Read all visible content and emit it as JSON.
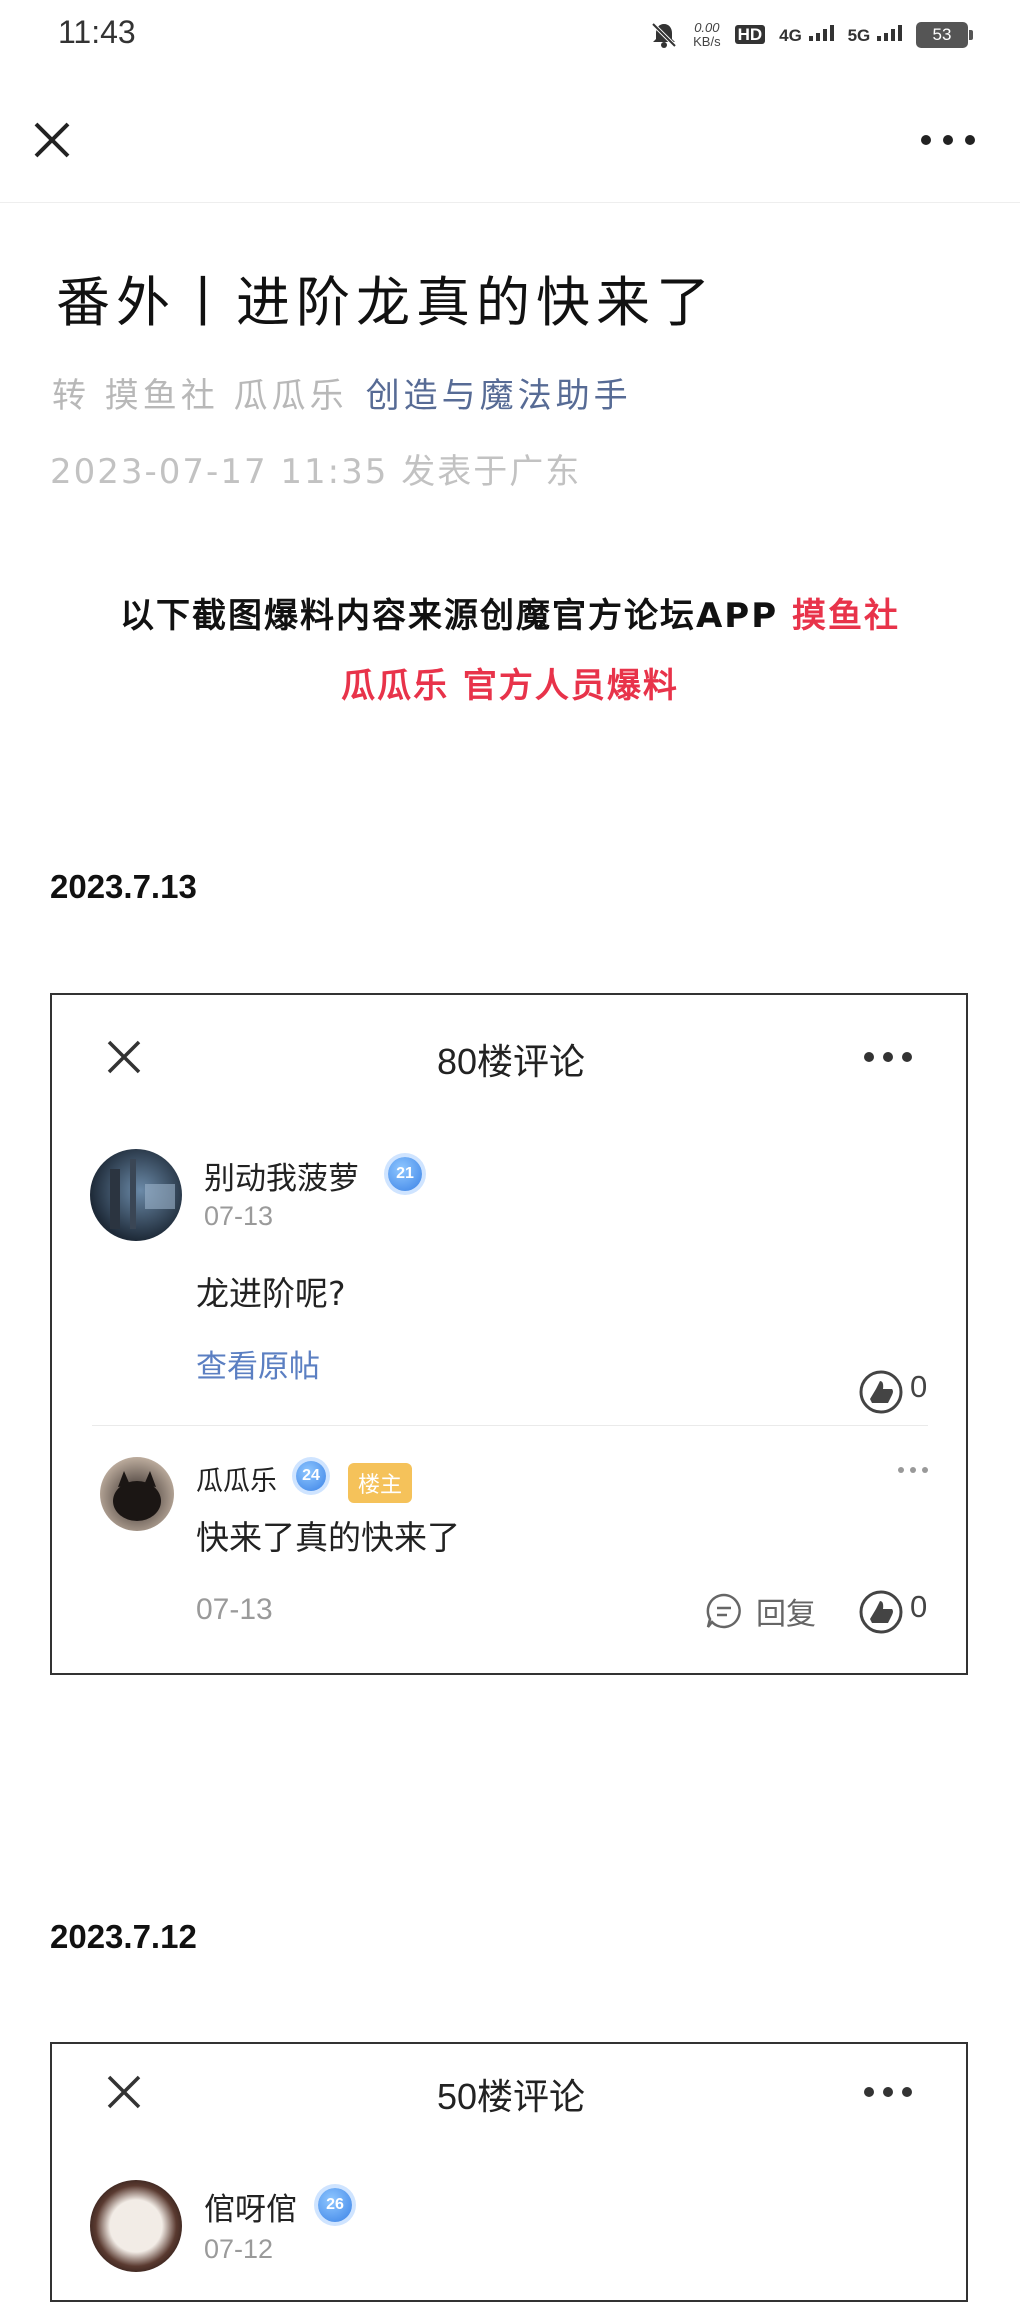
{
  "status_bar": {
    "time": "11:43",
    "net_speed_value": "0.00",
    "net_speed_unit": "KB/s",
    "hd": "HD",
    "network_1": "4G",
    "network_2": "5G",
    "battery": "53"
  },
  "article": {
    "title": "番外丨进阶龙真的快来了",
    "byline_prefix": "转 摸鱼社 瓜瓜乐",
    "account_name": "创造与魔法助手",
    "published": "2023-07-17 11:35  发表于广东",
    "intro_line1_black": "以下截图爆料内容来源创魔官方论坛APP",
    "intro_line1_red": "摸鱼社",
    "intro_line2_red": "瓜瓜乐 官方人员爆料"
  },
  "sections": [
    {
      "date": "2023.7.13",
      "card_title": "80楼评论",
      "post": {
        "user": "别动我菠萝",
        "level": "21",
        "date": "07-13",
        "text": "龙进阶呢?",
        "link": "查看原帖",
        "likes": "0"
      },
      "reply": {
        "user": "瓜瓜乐",
        "level": "24",
        "badge": "楼主",
        "text": "快来了真的快来了",
        "date": "07-13",
        "reply_label": "回复",
        "likes": "0"
      }
    },
    {
      "date": "2023.7.12",
      "card_title": "50楼评论",
      "post": {
        "user": "倌呀倌",
        "level": "26",
        "date": "07-12"
      }
    }
  ],
  "colors": {
    "accent_link": "#576b95",
    "highlight_red": "#e8334a",
    "level_badge": "#3b82e6",
    "owner_badge": "#f5c25a"
  }
}
